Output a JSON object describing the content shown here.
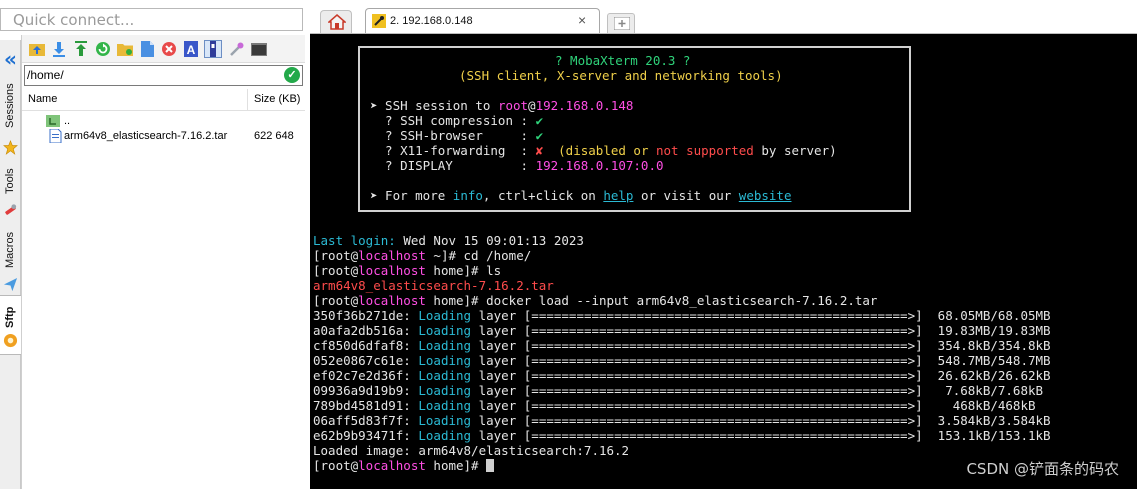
{
  "quick_connect": {
    "placeholder": "Quick connect..."
  },
  "side_tabs": [
    {
      "label": "Sessions",
      "icon": "star-icon"
    },
    {
      "label": "Tools",
      "icon": "tools-icon"
    },
    {
      "label": "Macros",
      "icon": "send-icon"
    },
    {
      "label": "Sftp",
      "icon": "sftp-icon"
    }
  ],
  "sftp": {
    "path": "/home/",
    "columns": {
      "name": "Name",
      "size": "Size (KB)"
    },
    "files": [
      {
        "name": "..",
        "size": "",
        "icon": "parent-folder-icon"
      },
      {
        "name": "arm64v8_elasticsearch-7.16.2.tar",
        "size": "622 648",
        "icon": "file-icon"
      }
    ]
  },
  "tabs": {
    "session_title": "2. 192.168.0.148",
    "close": "×"
  },
  "terminal": {
    "banner": {
      "title": "? MobaXterm 20.3 ?",
      "subtitle": "(SSH client, X-server and networking tools)",
      "session_prefix": "➤ SSH session to ",
      "session_user": "root",
      "session_at": "@",
      "session_host": "192.168.0.148",
      "compression_label": "  ? SSH compression : ",
      "check": "✔",
      "browser_label": "  ? SSH-browser     : ",
      "x11_label": "  ? X11-forwarding  : ",
      "cross": "✘",
      "x11_paren_open": "  (disabled or ",
      "x11_not_supported": "not supported",
      "x11_paren_close": " by server)",
      "display_label": "  ? DISPLAY         : ",
      "display_value": "192.168.0.107:0.0",
      "more_prefix": "➤ For more ",
      "more_info": "info",
      "more_mid": ", ctrl+click on ",
      "more_help": "help",
      "more_or": " or visit our ",
      "more_website": "website"
    },
    "last_login_label": "Last login:",
    "last_login_value": " Wed Nov 15 09:01:13 2023",
    "prompt_open": "[root@",
    "prompt_host": "localhost",
    "commands": [
      {
        "dir": " ~]# ",
        "cmd": "cd /home/"
      },
      {
        "dir": " home]# ",
        "cmd": "ls"
      },
      {
        "dir": " home]# ",
        "cmd": "docker load --input arm64v8_elasticsearch-7.16.2.tar"
      }
    ],
    "ls_output": "arm64v8_elasticsearch-7.16.2.tar",
    "layers": [
      {
        "id": "350f36b271de:",
        "bar": "[==================================================>]",
        "progress": "  68.05MB/68.05MB"
      },
      {
        "id": "a0afa2db516a:",
        "bar": "[==================================================>]",
        "progress": "  19.83MB/19.83MB"
      },
      {
        "id": "cf850d6dfaf8:",
        "bar": "[==================================================>]",
        "progress": "  354.8kB/354.8kB"
      },
      {
        "id": "052e0867c61e:",
        "bar": "[==================================================>]",
        "progress": "  548.7MB/548.7MB"
      },
      {
        "id": "ef02c7e2d36f:",
        "bar": "[==================================================>]",
        "progress": "  26.62kB/26.62kB"
      },
      {
        "id": "09936a9d19b9:",
        "bar": "[==================================================>]",
        "progress": "   7.68kB/7.68kB"
      },
      {
        "id": "789bd4581d91:",
        "bar": "[==================================================>]",
        "progress": "    468kB/468kB"
      },
      {
        "id": "06aff5d83f7f:",
        "bar": "[==================================================>]",
        "progress": "  3.584kB/3.584kB"
      },
      {
        "id": "e62b9b93471f:",
        "bar": "[==================================================>]",
        "progress": "  153.1kB/153.1kB"
      }
    ],
    "loading_label": "Loading",
    "layer_word": "layer",
    "loaded_image": "Loaded image: arm64v8/elasticsearch:7.16.2",
    "final_dir": " home]# "
  },
  "watermark": "CSDN @铲面条的码农",
  "colors": {
    "terminal_bg": "#000000",
    "prompt_host": "#ff4fe4",
    "accent_cyan": "#2bbad4",
    "banner_green": "#2fd27a",
    "banner_yellow": "#f0d04a"
  }
}
